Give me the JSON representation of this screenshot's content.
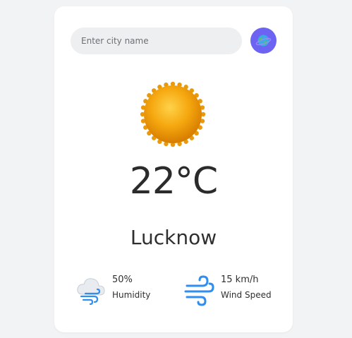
{
  "search": {
    "placeholder": "Enter city name",
    "value": "",
    "button_icon": "globe-icon"
  },
  "weather": {
    "condition_icon": "sun-icon",
    "temperature": "22°C",
    "city": "Lucknow"
  },
  "details": {
    "humidity": {
      "value": "50%",
      "label": "Humidity",
      "icon": "humidity-cloud-icon"
    },
    "wind": {
      "value": "15 km/h",
      "label": "Wind Speed",
      "icon": "wind-icon"
    }
  },
  "colors": {
    "accent": "#6c63f2",
    "background": "#f2f3f5",
    "card": "#ffffff",
    "input_bg": "#eeeff1",
    "sun": "#f5a623"
  }
}
